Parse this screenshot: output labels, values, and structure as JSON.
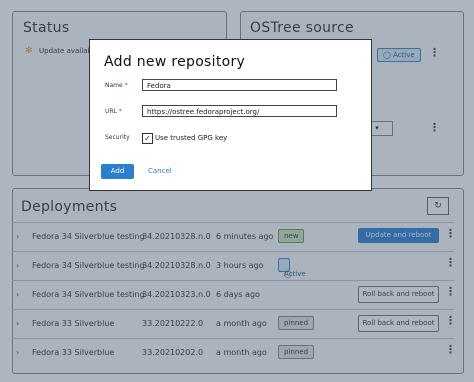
{
  "status_card": {
    "title": "Status",
    "update_text": "Update available"
  },
  "source_card": {
    "title": "OSTree source",
    "active_badge": "Active"
  },
  "deployments_card": {
    "title": "Deployments",
    "rows": [
      {
        "name": "Fedora 34 Silverblue testing",
        "version": "34.20210328.n.0",
        "time": "6 minutes ago",
        "badge": "new",
        "action": "Update and reboot"
      },
      {
        "name": "Fedora 34 Silverblue testing",
        "version": "34.20210328.n.0",
        "time": "3 hours ago",
        "badge": "Active",
        "action": ""
      },
      {
        "name": "Fedora 34 Silverblue testing",
        "version": "34.20210323.n.0",
        "time": "6 days ago",
        "badge": "",
        "action": "Roll back and reboot"
      },
      {
        "name": "Fedora 33 Silverblue",
        "version": "33.20210222.0",
        "time": "a month ago",
        "badge": "pinned",
        "action": "Roll back and reboot"
      },
      {
        "name": "Fedora 33 Silverblue",
        "version": "33.20210202.0",
        "time": "a month ago",
        "badge": "pinned",
        "action": ""
      }
    ]
  },
  "modal": {
    "title": "Add new repository",
    "name_label": "Name",
    "name_value": "Fedora",
    "url_label": "URL",
    "url_value": "https://ostree.fedoraproject.org/",
    "security_label": "Security",
    "gpg_label": "Use trusted GPG key",
    "gpg_checked": "✓",
    "required_mark": "*",
    "add_label": "Add",
    "cancel_label": "Cancel"
  },
  "colors": {
    "primary": "#2b7fd1",
    "overlay": "#3c5069",
    "required": "#c0392b"
  }
}
